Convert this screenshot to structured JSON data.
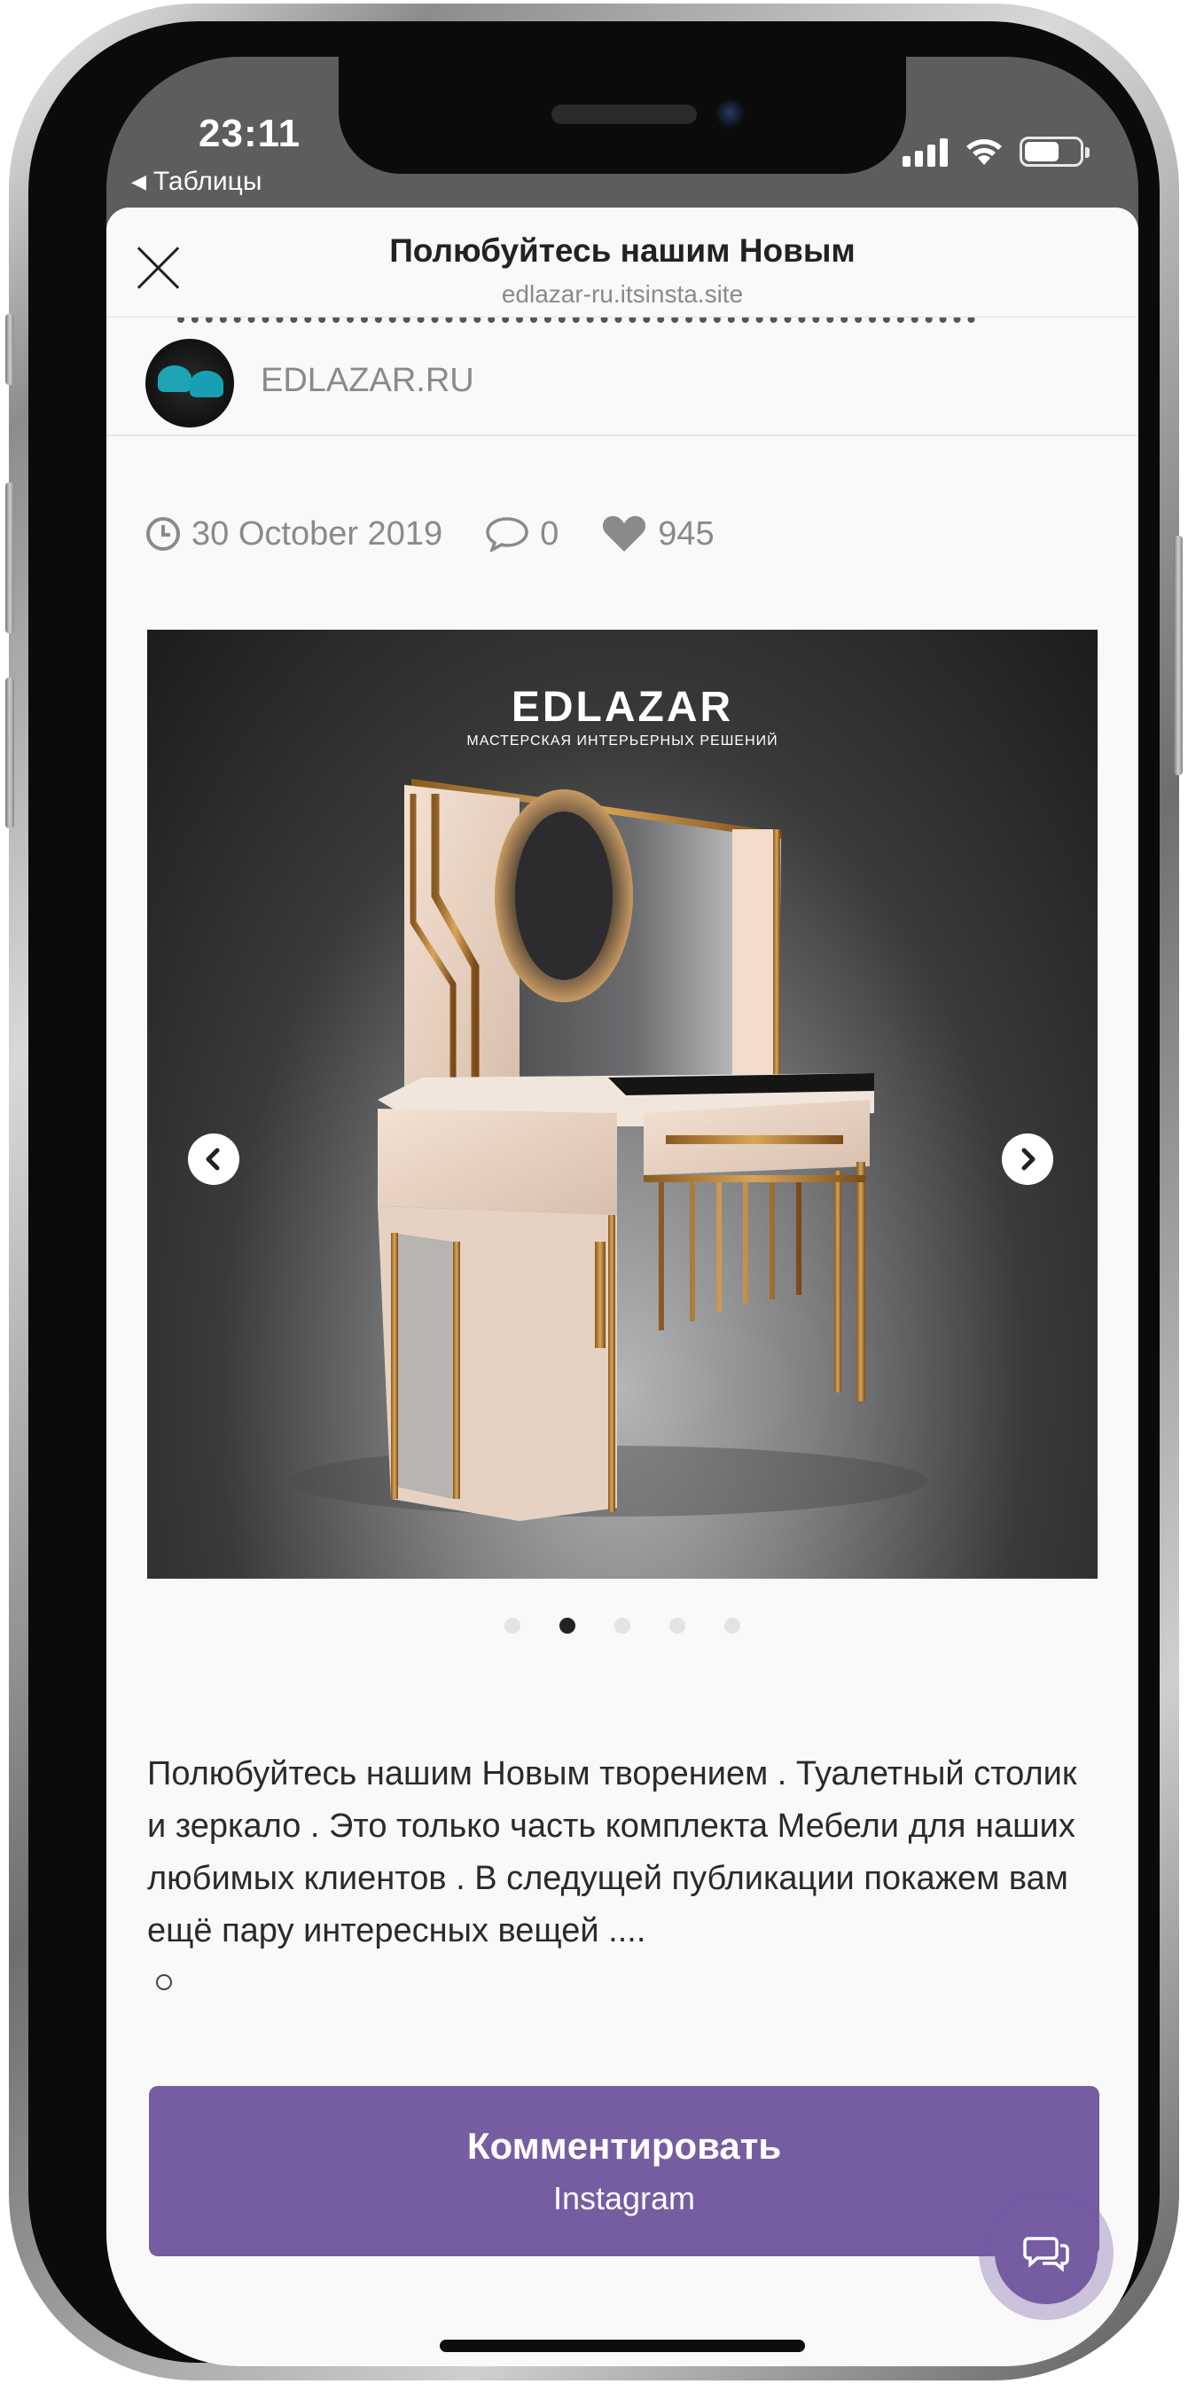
{
  "status_bar": {
    "time": "23:11",
    "back_label": "Таблицы"
  },
  "header": {
    "title": "Полюбуйтесь нашим Новым",
    "url": "edlazar-ru.itsinsta.site"
  },
  "author": {
    "name": "EDLAZAR.RU"
  },
  "meta": {
    "date": "30 October 2019",
    "comments": "0",
    "likes": "945"
  },
  "carousel": {
    "brand_logo": "EDLAZAR",
    "brand_tagline": "МАСТЕРСКАЯ ИНТЕРЬЕРНЫХ РЕШЕНИЙ",
    "slide_count": 5,
    "active_slide": 2
  },
  "post": {
    "text": "Полюбуйтесь нашим Новым творением . Туалетный столик и зеркало . Это только часть комплекта Мебели для наших любимых клиентов . В следущей публикации покажем вам ещё пару интересных вещей ...."
  },
  "comment_button": {
    "label": "Комментировать",
    "sublabel": "Instagram"
  },
  "colors": {
    "accent": "#765da2",
    "background": "#f9f9f9",
    "muted_text": "#8a8a8a"
  }
}
